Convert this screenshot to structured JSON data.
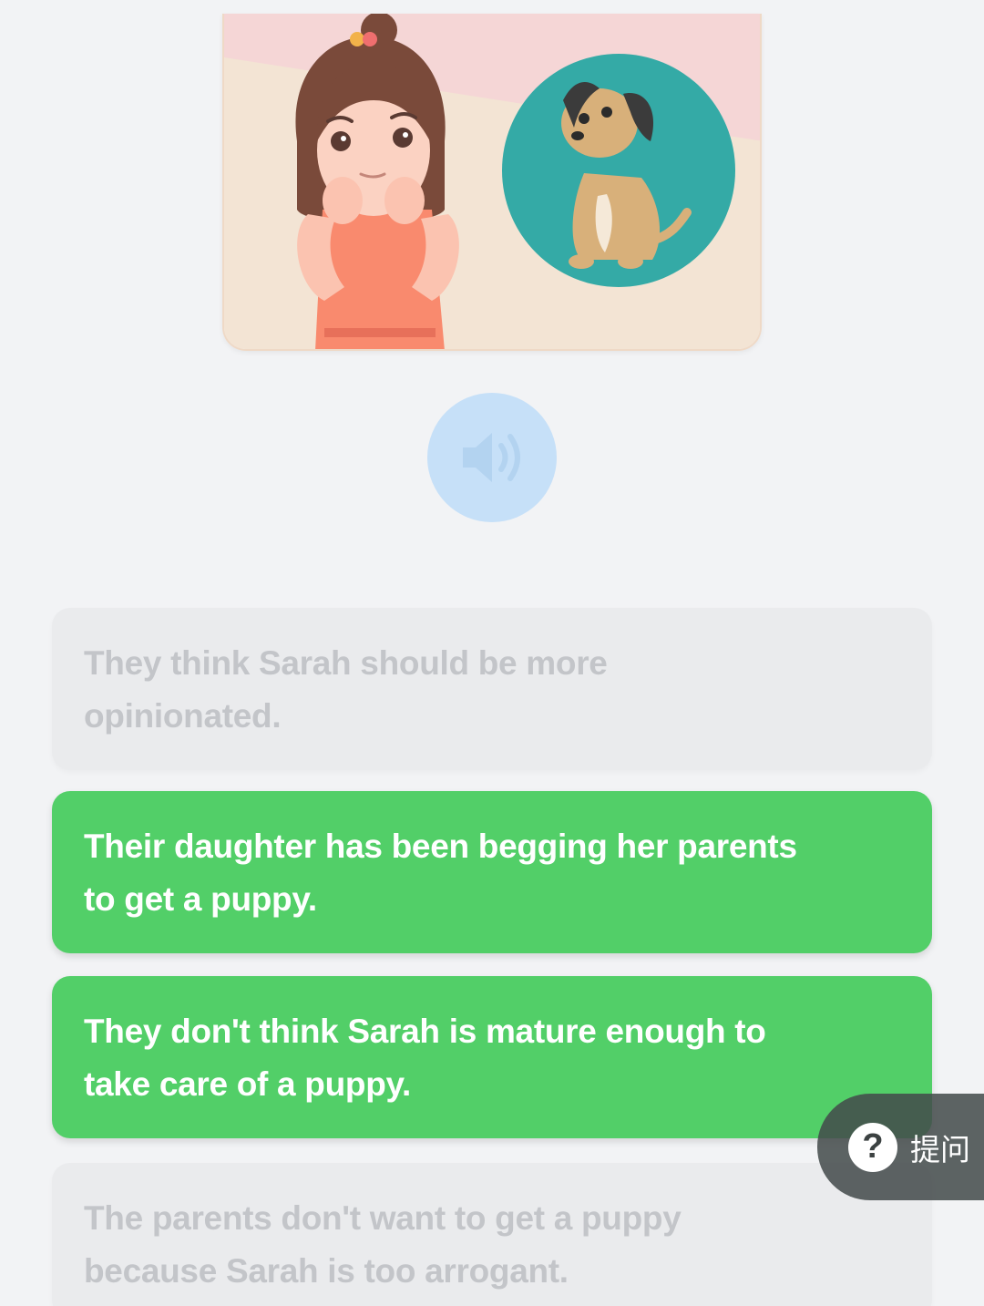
{
  "audio": {
    "icon": "speaker-icon"
  },
  "options": [
    {
      "lines": [
        "They think Sarah should be more",
        "opinionated."
      ],
      "state": "dim"
    },
    {
      "lines": [
        "Their daughter has been begging her parents",
        "to get a puppy."
      ],
      "state": "active"
    },
    {
      "lines": [
        "They don't think Sarah is mature enough to",
        "take care of a puppy."
      ],
      "state": "active"
    },
    {
      "lines": [
        "The parents don't want to get a puppy",
        "because Sarah is too arrogant."
      ],
      "state": "dim"
    }
  ],
  "ask": {
    "icon_glyph": "?",
    "label": "提问"
  },
  "colors": {
    "active_green": "#52cf68",
    "dim_bg": "#eaebed",
    "dim_text": "#c3c5c9",
    "audio_bg": "#c6e0f8",
    "page_bg": "#f2f3f5"
  }
}
